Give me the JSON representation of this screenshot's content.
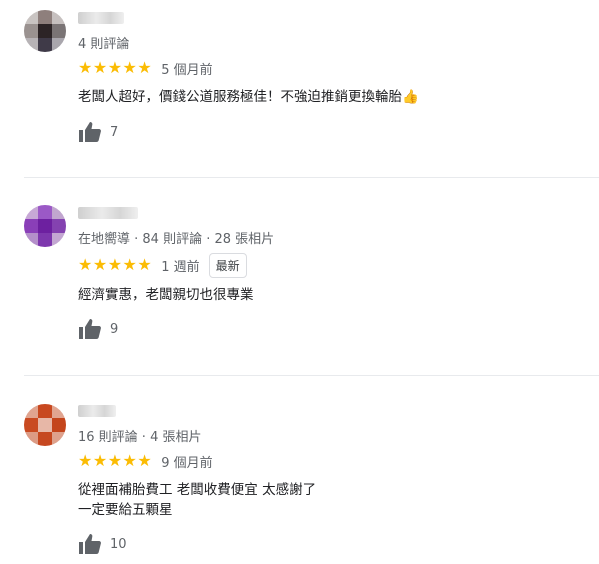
{
  "reviews": [
    {
      "meta": "4 則評論",
      "stars": 5,
      "date": "5 個月前",
      "badge": "",
      "text_lines": [
        "老闆人超好，價錢公道服務極佳！不強迫推銷更換輪胎👍"
      ],
      "likes": "7"
    },
    {
      "meta": "在地嚮導 · 84 則評論 · 28 張相片",
      "stars": 5,
      "date": "1 週前",
      "badge": "最新",
      "text_lines": [
        "經濟實惠，老闆親切也很專業"
      ],
      "likes": "9"
    },
    {
      "meta": "16 則評論 · 4 張相片",
      "stars": 5,
      "date": "9 個月前",
      "badge": "",
      "text_lines": [
        "從裡面補胎費工  老闆收費便宜  太感謝了",
        "一定要給五顆星"
      ],
      "likes": "10"
    }
  ],
  "icons": {
    "star": "star-icon",
    "like": "thumbs-up-icon"
  },
  "colors": {
    "star": "#fbbc04",
    "secondary_text": "#5f6368",
    "divider": "#e8eaed"
  }
}
